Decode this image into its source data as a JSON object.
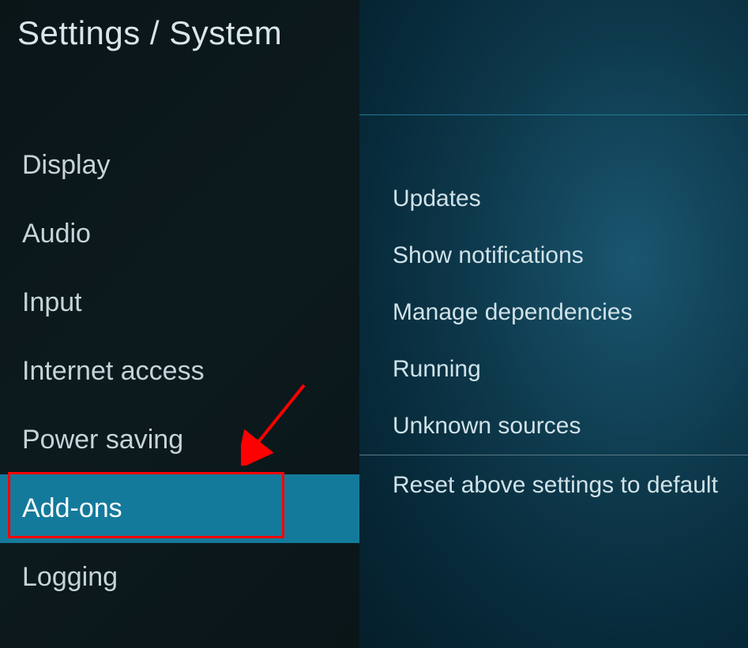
{
  "header": {
    "title": "Settings / System"
  },
  "sidebar": {
    "items": [
      {
        "label": "Display"
      },
      {
        "label": "Audio"
      },
      {
        "label": "Input"
      },
      {
        "label": "Internet access"
      },
      {
        "label": "Power saving"
      },
      {
        "label": "Add-ons"
      },
      {
        "label": "Logging"
      }
    ]
  },
  "content": {
    "items": [
      {
        "label": "Updates"
      },
      {
        "label": "Show notifications"
      },
      {
        "label": "Manage dependencies"
      },
      {
        "label": "Running"
      },
      {
        "label": "Unknown sources"
      }
    ],
    "reset": "Reset above settings to default"
  }
}
